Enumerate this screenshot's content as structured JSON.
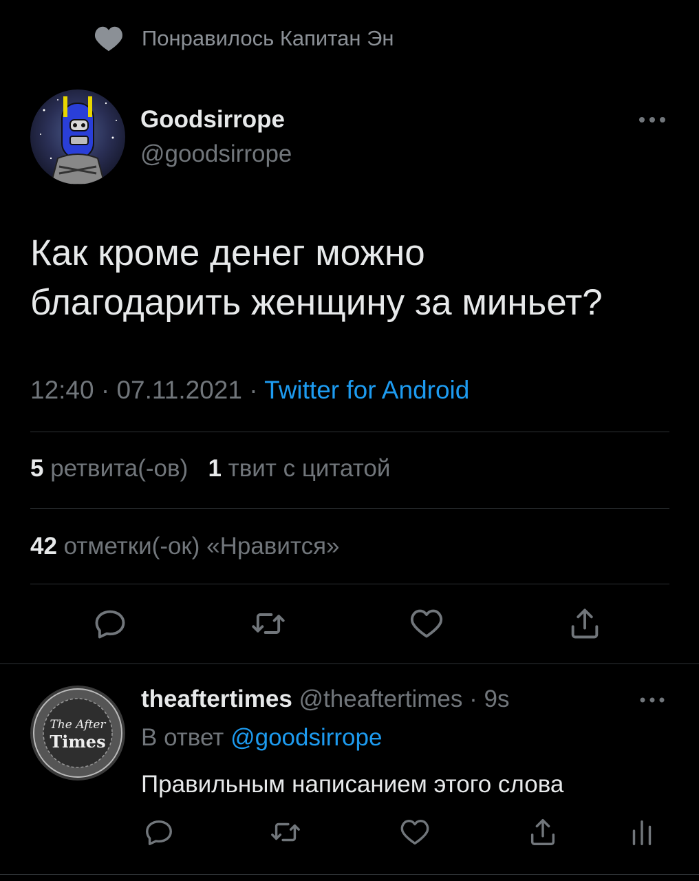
{
  "social_context": {
    "icon": "heart-filled-icon",
    "text": "Понравилось Капитан Эн"
  },
  "tweet": {
    "display_name": "Goodsirrope",
    "handle": "@goodsirrope",
    "text_line1": "Как кроме денег можно",
    "text_line2": "благодарить женщину за миньет?",
    "time": "12:40",
    "separator": "·",
    "date": "07.11.2021",
    "source": "Twitter for Android"
  },
  "stats": {
    "retweets_count": "5",
    "retweets_label": "ретвита(-ов)",
    "quotes_count": "1",
    "quotes_label": "твит с цитатой",
    "likes_count": "42",
    "likes_label": "отметки(-ок) «Нравится»"
  },
  "actions": [
    "reply-icon",
    "retweet-icon",
    "like-icon",
    "share-icon"
  ],
  "reply_tweet": {
    "display_name": "theaftertimes",
    "handle": "@theaftertimes",
    "age": "· 9s",
    "replying_to_label": "В ответ",
    "replying_to_handle": "@goodsirrope",
    "text": "Правильным написанием этого слова",
    "avatar_text_line1": "The After",
    "avatar_text_line2": "Times"
  },
  "colors": {
    "background": "#000000",
    "text": "#e7e9ea",
    "secondary": "#71767b",
    "accent": "#1d9bf0",
    "divider": "#2f3336"
  }
}
